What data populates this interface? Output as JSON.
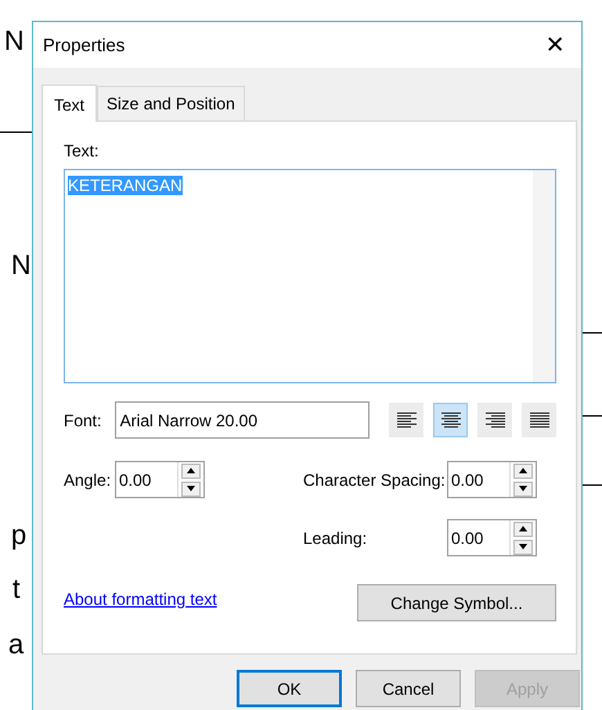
{
  "background_fragments": [
    "N",
    "N",
    "p",
    "t",
    "a"
  ],
  "window": {
    "title": "Properties",
    "close": "✕"
  },
  "tabs": [
    {
      "label": "Text",
      "selected": true
    },
    {
      "label": "Size and Position",
      "selected": false
    }
  ],
  "text_label": "Text:",
  "text_value": {
    "text": "KETERANGAN",
    "selected": true
  },
  "font": {
    "label": "Font:",
    "value": "Arial Narrow 20.00"
  },
  "alignment_buttons": [
    {
      "kind": "left",
      "selected": false
    },
    {
      "kind": "center",
      "selected": true
    },
    {
      "kind": "right",
      "selected": false
    },
    {
      "kind": "justify",
      "selected": false
    }
  ],
  "angle": {
    "label": "Angle:",
    "value": "0.00"
  },
  "character_spacing": {
    "label": "Character Spacing:",
    "value": "0.00"
  },
  "leading": {
    "label": "Leading:",
    "value": "0.00"
  },
  "link": "About formatting text",
  "change_symbol_button": "Change Symbol...",
  "buttons": [
    {
      "label": "OK",
      "kind": "default",
      "disabled": false
    },
    {
      "label": "Cancel",
      "kind": "normal",
      "disabled": false
    },
    {
      "label": "Apply",
      "kind": "normal",
      "disabled": true
    }
  ]
}
